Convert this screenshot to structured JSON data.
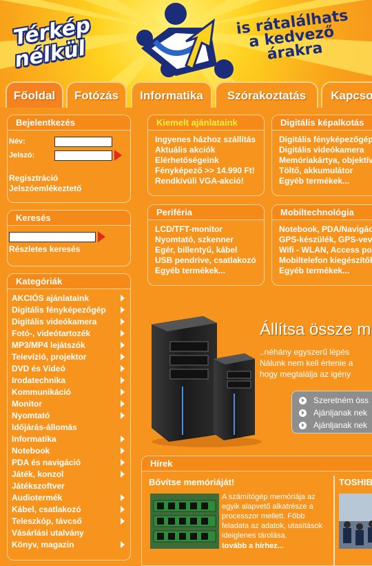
{
  "header": {
    "slogan_left": [
      "Térkép",
      "nélkül"
    ],
    "slogan_right": [
      "is rátalálhats",
      "a kedvező",
      "árakra"
    ]
  },
  "tabs": [
    {
      "label": "Főoldal"
    },
    {
      "label": "Fotózás"
    },
    {
      "label": "Informatika"
    },
    {
      "label": "Szórakoztatás"
    },
    {
      "label": "Kapcso"
    }
  ],
  "login": {
    "title": "Bejelentkezés",
    "name_label": "Név:",
    "password_label": "Jelszó:",
    "register": "Regisztráció",
    "forgot_password": "Jelszóemlékeztető"
  },
  "search": {
    "title": "Keresés",
    "advanced": "Részletes keresés"
  },
  "categories": {
    "title": "Kategóriák",
    "items": [
      {
        "label": "AKCIÓS ajánlataink",
        "arrow": true
      },
      {
        "label": "Digitális fényképezőgép",
        "arrow": true
      },
      {
        "label": "Digitális videókamera",
        "arrow": true
      },
      {
        "label": "Fotó-, videótartozék",
        "arrow": true
      },
      {
        "label": "MP3/MP4 lejátszók",
        "arrow": true
      },
      {
        "label": "Televízió, projektor",
        "arrow": true
      },
      {
        "label": "DVD és Videó",
        "arrow": true
      },
      {
        "label": "Irodatechnika",
        "arrow": true
      },
      {
        "label": "Kommunikáció",
        "arrow": true
      },
      {
        "label": "Monitor",
        "arrow": true
      },
      {
        "label": "Nyomtató",
        "arrow": true
      },
      {
        "label": "Időjárás-állomás",
        "arrow": false
      },
      {
        "label": "Informatika",
        "arrow": true
      },
      {
        "label": "Notebook",
        "arrow": true
      },
      {
        "label": "PDA és navigáció",
        "arrow": true
      },
      {
        "label": "Játék, konzol",
        "arrow": true
      },
      {
        "label": "Játékszoftver",
        "arrow": false
      },
      {
        "label": "Audiotermék",
        "arrow": true
      },
      {
        "label": "Kábel, csatlakozó",
        "arrow": true
      },
      {
        "label": "Teleszkóp, távcső",
        "arrow": true
      },
      {
        "label": "Vásárlási utalvány",
        "arrow": false
      },
      {
        "label": "Könyv, magazin",
        "arrow": true
      }
    ]
  },
  "featured": {
    "title": "Kiemelt ajánlataink",
    "items": [
      "Ingyenes házhoz szállítás",
      "Aktuális akciók",
      "Elérhetőségeink",
      "Fényképező >> 14.990 Ft!",
      "Rendkívüli VGA-akció!"
    ]
  },
  "digital_imaging": {
    "title": "Digitális képalkotás",
    "items": [
      "Digitális fényképezőgép",
      "Digitális videókamera",
      "Memóriakártya, objektív",
      "Töltő, akkumulátor",
      "Egyéb termékek..."
    ]
  },
  "peripheral": {
    "title": "Periféria",
    "items": [
      "LCD/TFT-monitor",
      "Nyomtató, szkenner",
      "Egér, billentyű, kábel",
      "USB pendrive, csatlakozó",
      "Egyéb termékek..."
    ]
  },
  "mobile": {
    "title": "Mobiltechnológia",
    "items": [
      "Notebook, PDA/Navigáció",
      "GPS-készülék, GPS-vevő",
      "Wifi - WLAN, Access poi",
      "Mobiltelefon kiegészítők",
      "Egyéb termékek..."
    ]
  },
  "promo": {
    "title": "Állítsa össze m",
    "text": [
      "..néhány egyszerű lépés",
      "Nálunk nem kell értenie a",
      "hogy megtalálja az igény"
    ],
    "links": [
      "Szeretném öss",
      "Ajánljanak nek",
      "Ajánljanak nek"
    ]
  },
  "news": {
    "title": "Hírek",
    "item1": {
      "title": "Bővítse memóriáját!",
      "text": "A számítógép memóriája az egyik alapvető alkatrésze a processzor mellett. Főbb feladata az adatok, utasítások ideiglenes tárolása.",
      "more": "tovább a hírhez..."
    },
    "item2": {
      "title": "TOSHIB"
    }
  },
  "colors": {
    "background": "#f7941d",
    "accent_yellow": "#ffef40",
    "arrow_red": "#e32b1d",
    "brand_blue": "#1b2c7a"
  }
}
